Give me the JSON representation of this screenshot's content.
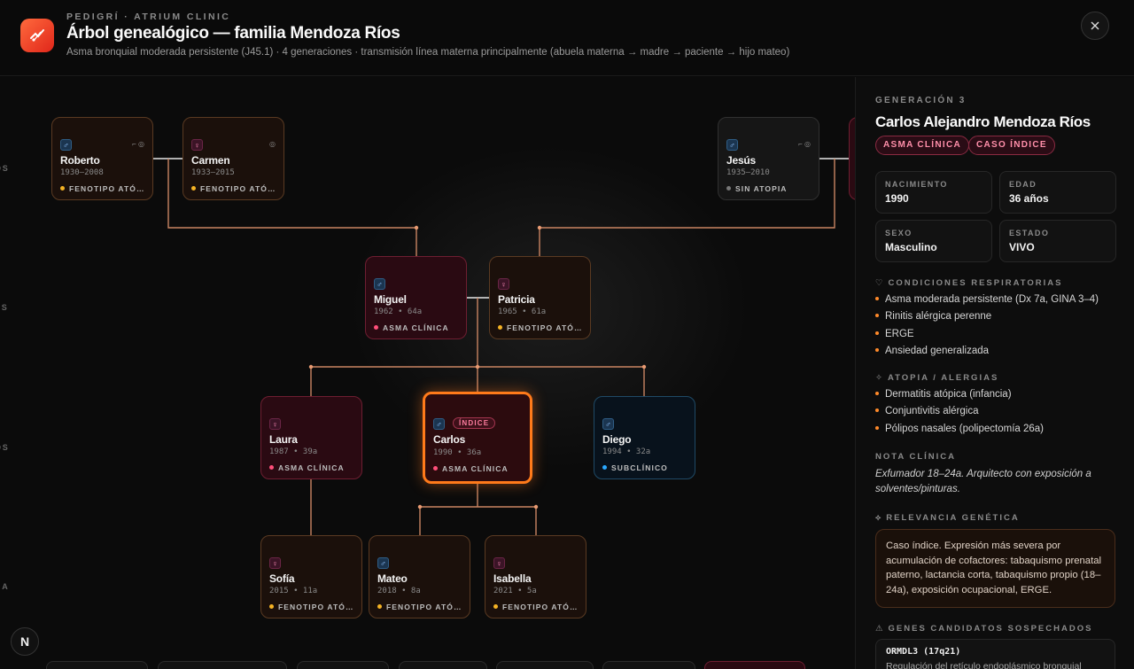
{
  "header": {
    "kicker": "PEDIGRÍ · ATRIUM CLINIC",
    "title": "Árbol genealógico — familia Mendoza Ríos",
    "subtitle": "Asma bronquial moderada persistente (J45.1) · 4 generaciones · transmisión línea materna principalmente (abuela materna → madre → paciente → hijo mateo)",
    "close_icon": "close-icon"
  },
  "canvas": {
    "generation_labels": [
      "OS",
      "ES",
      "OS",
      "NA"
    ],
    "nodes": {
      "roberto": {
        "sex": "♂",
        "name": "Roberto",
        "meta": "1930–2008",
        "tag": "FENOTIPO ATÓPICO",
        "dot": "#f5b324",
        "icons": "⌐ ◎"
      },
      "carmen": {
        "sex": "♀",
        "name": "Carmen",
        "meta": "1933–2015",
        "tag": "FENOTIPO ATÓPICO",
        "dot": "#f5b324",
        "icons": "◎"
      },
      "jesus": {
        "sex": "♂",
        "name": "Jesús",
        "meta": "1935–2010",
        "tag": "SIN ATOPIA",
        "dot": "#777777",
        "icons": "⌐ ◎"
      },
      "miguel": {
        "sex": "♂",
        "name": "Miguel",
        "meta": "1962  •  64a",
        "tag": "ASMA CLÍNICA",
        "dot": "#ff4f7a"
      },
      "patricia": {
        "sex": "♀",
        "name": "Patricia",
        "meta": "1965  •  61a",
        "tag": "FENOTIPO ATÓPICO",
        "dot": "#f5b324"
      },
      "laura": {
        "sex": "♀",
        "name": "Laura",
        "meta": "1987  •  39a",
        "tag": "ASMA CLÍNICA",
        "dot": "#ff4f7a"
      },
      "carlos": {
        "sex": "♂",
        "name": "Carlos",
        "meta": "1990  •  36a",
        "tag": "ASMA CLÍNICA",
        "dot": "#ff4f7a",
        "badge": "ÍNDICE"
      },
      "diego": {
        "sex": "♂",
        "name": "Diego",
        "meta": "1994  •  32a",
        "tag": "SUBCLÍNICO",
        "dot": "#2aa8ff"
      },
      "sofia": {
        "sex": "♀",
        "name": "Sofía",
        "meta": "2015  •  11a",
        "tag": "FENOTIPO ATÓPICO",
        "dot": "#f5b324"
      },
      "mateo": {
        "sex": "♂",
        "name": "Mateo",
        "meta": "2018  •  8a",
        "tag": "FENOTIPO ATÓPICO",
        "dot": "#f5b324"
      },
      "isabella": {
        "sex": "♀",
        "name": "Isabella",
        "meta": "2021  •  5a",
        "tag": "FENOTIPO ATÓPICO",
        "dot": "#f5b324"
      }
    },
    "n_logo": "N"
  },
  "panel": {
    "kicker": "GENERACIÓN 3",
    "name": "Carlos Alejandro Mendoza Ríos",
    "chips": [
      "ASMA CLÍNICA",
      "CASO ÍNDICE"
    ],
    "info": [
      {
        "label": "NACIMIENTO",
        "value": "1990"
      },
      {
        "label": "EDAD",
        "value": "36 años"
      },
      {
        "label": "SEXO",
        "value": "Masculino"
      },
      {
        "label": "ESTADO",
        "value": "VIVO"
      }
    ],
    "respiratory_title": "CONDICIONES RESPIRATORIAS",
    "respiratory": [
      "Asma moderada persistente (Dx 7a, GINA 3–4)",
      "Rinitis alérgica perenne",
      "ERGE",
      "Ansiedad generalizada"
    ],
    "atopy_title": "ATOPIA / ALERGIAS",
    "atopy": [
      "Dermatitis atópica (infancia)",
      "Conjuntivitis alérgica",
      "Pólipos nasales (polipectomía 26a)"
    ],
    "note_title": "NOTA CLÍNICA",
    "note": "Exfumador 18–24a. Arquitecto con exposición a solventes/pinturas.",
    "relevance_title": "RELEVANCIA GENÉTICA",
    "relevance": "Caso índice. Expresión más severa por acumulación de cofactores: tabaquismo prenatal paterno, lactancia corta, tabaquismo propio (18–24a), exposición ocupacional, ERGE.",
    "genes_title": "GENES CANDIDATOS SOSPECHADOS",
    "gene_name": "ORMDL3 (17q21)",
    "gene_desc": "Regulación del retículo endoplásmico bronquial"
  }
}
